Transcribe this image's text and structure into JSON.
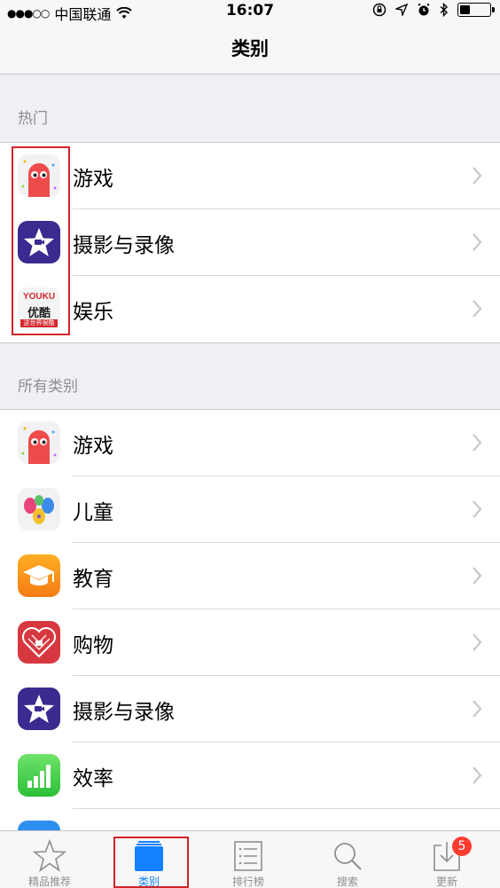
{
  "status_bar": {
    "signal": "●●●○○",
    "carrier": "中国联通",
    "time": "16:07",
    "battery_level": 0.35
  },
  "nav": {
    "title": "类别"
  },
  "sections": [
    {
      "header": "热门",
      "items": [
        {
          "label": "游戏",
          "icon": "game-icon"
        },
        {
          "label": "摄影与录像",
          "icon": "photo-video-icon"
        },
        {
          "label": "娱乐",
          "icon": "youku-icon"
        }
      ]
    },
    {
      "header": "所有类别",
      "items": [
        {
          "label": "游戏",
          "icon": "game-icon"
        },
        {
          "label": "儿童",
          "icon": "kids-icon"
        },
        {
          "label": "教育",
          "icon": "education-icon"
        },
        {
          "label": "购物",
          "icon": "shopping-icon"
        },
        {
          "label": "摄影与录像",
          "icon": "photo-video-icon"
        },
        {
          "label": "效率",
          "icon": "productivity-icon"
        }
      ]
    }
  ],
  "youku_logo": {
    "line1": "YOUKU",
    "line2": "优酷",
    "line3": "这世界很酷"
  },
  "tab_bar": {
    "tabs": [
      {
        "label": "精品推荐",
        "icon": "star-icon"
      },
      {
        "label": "类别",
        "icon": "categories-icon",
        "active": true
      },
      {
        "label": "排行榜",
        "icon": "list-icon"
      },
      {
        "label": "搜索",
        "icon": "search-icon"
      },
      {
        "label": "更新",
        "icon": "updates-icon",
        "badge": "5"
      }
    ]
  },
  "colors": {
    "accent": "#1380ff",
    "highlight": "#d0242a",
    "badge": "#ff3b30"
  }
}
